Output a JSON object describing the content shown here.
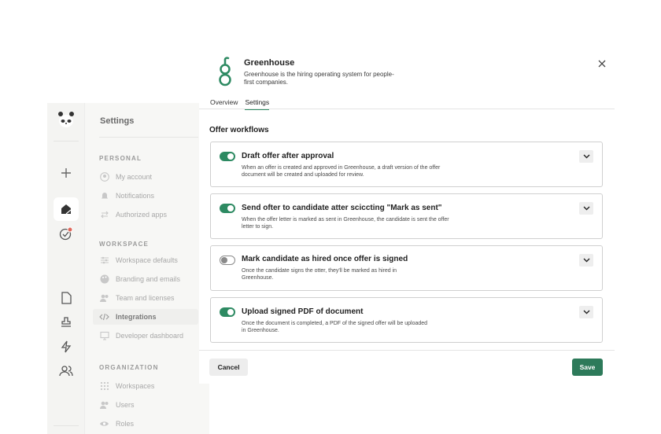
{
  "background": {
    "settings_title": "Settings",
    "sections": [
      {
        "label": "PERSONAL",
        "items": [
          {
            "label": "My account",
            "icon": "user-circle-icon"
          },
          {
            "label": "Notifications",
            "icon": "bell-icon"
          },
          {
            "label": "Authorized apps",
            "icon": "swap-arrows-icon"
          }
        ]
      },
      {
        "label": "WORKSPACE",
        "items": [
          {
            "label": "Workspace defaults",
            "icon": "sliders-icon"
          },
          {
            "label": "Branding and emails",
            "icon": "palette-icon"
          },
          {
            "label": "Team and licenses",
            "icon": "team-icon"
          },
          {
            "label": "Integrations",
            "icon": "code-icon",
            "active": true
          },
          {
            "label": "Developer dashboard",
            "icon": "monitor-icon"
          }
        ]
      },
      {
        "label": "ORGANIZATION",
        "items": [
          {
            "label": "Workspaces",
            "icon": "grid-icon"
          },
          {
            "label": "Users",
            "icon": "users-icon"
          },
          {
            "label": "Roles",
            "icon": "eye-icon"
          }
        ]
      }
    ]
  },
  "modal": {
    "app_name": "Greenhouse",
    "app_description": "Greenhouse is the hiring operating system for people-first companies.",
    "tabs": [
      {
        "label": "Overview",
        "active": false
      },
      {
        "label": "Settings",
        "active": true
      }
    ],
    "section_title": "Offer workflows",
    "workflows": [
      {
        "title": "Draft offer after approval",
        "description": "When an offer is created and approved in Greenhouse, a draft version of the offer document will be created and uploaded for review.",
        "enabled": true
      },
      {
        "title": "Send ofter to candidate atter sciccting \"Mark as sent\"",
        "description": "When the offer letter is marked as sent in Greenhouse, the candidate is sent the offer letter to sign.",
        "enabled": true
      },
      {
        "title": "Mark candidate as hired once offer is signed",
        "description": "Once the candidate signs the otter, they'll be marked as hired in Greenhouse.",
        "enabled": false
      },
      {
        "title": "Upload signed PDF of document",
        "description": "Once the document is completed, a PDF of the signed offer will be uploaded in Greenhouse.",
        "enabled": true
      }
    ],
    "cancel_label": "Cancel",
    "save_label": "Save"
  },
  "colors": {
    "accent": "#2d8a62",
    "save_button": "#2d7a5a",
    "notification_dot": "#e0685b"
  }
}
